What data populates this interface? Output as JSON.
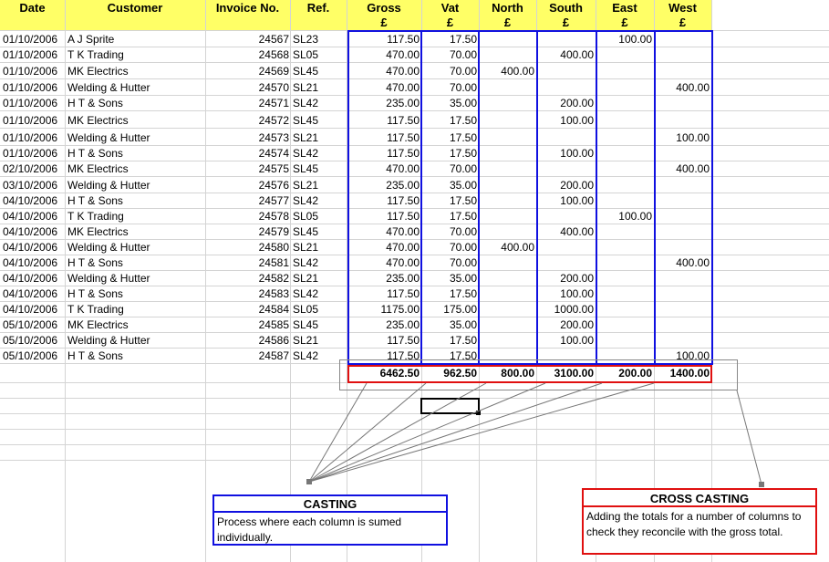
{
  "headers": {
    "date": "Date",
    "customer": "Customer",
    "invoice": "Invoice No.",
    "ref": "Ref.",
    "gross": "Gross",
    "vat": "Vat",
    "north": "North",
    "south": "South",
    "east": "East",
    "west": "West",
    "currency": "£"
  },
  "rows": [
    [
      "01/10/2006",
      "A J Sprite",
      "24567",
      "SL23",
      "117.50",
      "17.50",
      "",
      "",
      "100.00",
      ""
    ],
    [
      "01/10/2006",
      "T K Trading",
      "24568",
      "SL05",
      "470.00",
      "70.00",
      "",
      "400.00",
      "",
      ""
    ],
    [
      "01/10/2006",
      "MK Electrics",
      "24569",
      "SL45",
      "470.00",
      "70.00",
      "400.00",
      "",
      "",
      ""
    ],
    [
      "01/10/2006",
      "Welding & Hutter",
      "24570",
      "SL21",
      "470.00",
      "70.00",
      "",
      "",
      "",
      "400.00"
    ],
    [
      "01/10/2006",
      "H T & Sons",
      "24571",
      "SL42",
      "235.00",
      "35.00",
      "",
      "200.00",
      "",
      ""
    ],
    [
      "01/10/2006",
      "MK Electrics",
      "24572",
      "SL45",
      "117.50",
      "17.50",
      "",
      "100.00",
      "",
      ""
    ],
    [
      "01/10/2006",
      "Welding & Hutter",
      "24573",
      "SL21",
      "117.50",
      "17.50",
      "",
      "",
      "",
      "100.00"
    ],
    [
      "01/10/2006",
      "H T & Sons",
      "24574",
      "SL42",
      "117.50",
      "17.50",
      "",
      "100.00",
      "",
      ""
    ],
    [
      "02/10/2006",
      "MK Electrics",
      "24575",
      "SL45",
      "470.00",
      "70.00",
      "",
      "",
      "",
      "400.00"
    ],
    [
      "03/10/2006",
      "Welding & Hutter",
      "24576",
      "SL21",
      "235.00",
      "35.00",
      "",
      "200.00",
      "",
      ""
    ],
    [
      "04/10/2006",
      "H T & Sons",
      "24577",
      "SL42",
      "117.50",
      "17.50",
      "",
      "100.00",
      "",
      ""
    ],
    [
      "04/10/2006",
      "T K Trading",
      "24578",
      "SL05",
      "117.50",
      "17.50",
      "",
      "",
      "100.00",
      ""
    ],
    [
      "04/10/2006",
      "MK Electrics",
      "24579",
      "SL45",
      "470.00",
      "70.00",
      "",
      "400.00",
      "",
      ""
    ],
    [
      "04/10/2006",
      "Welding & Hutter",
      "24580",
      "SL21",
      "470.00",
      "70.00",
      "400.00",
      "",
      "",
      ""
    ],
    [
      "04/10/2006",
      "H T & Sons",
      "24581",
      "SL42",
      "470.00",
      "70.00",
      "",
      "",
      "",
      "400.00"
    ],
    [
      "04/10/2006",
      "Welding & Hutter",
      "24582",
      "SL21",
      "235.00",
      "35.00",
      "",
      "200.00",
      "",
      ""
    ],
    [
      "04/10/2006",
      "H T & Sons",
      "24583",
      "SL42",
      "117.50",
      "17.50",
      "",
      "100.00",
      "",
      ""
    ],
    [
      "04/10/2006",
      "T K Trading",
      "24584",
      "SL05",
      "1175.00",
      "175.00",
      "",
      "1000.00",
      "",
      ""
    ],
    [
      "05/10/2006",
      "MK Electrics",
      "24585",
      "SL45",
      "235.00",
      "35.00",
      "",
      "200.00",
      "",
      ""
    ],
    [
      "05/10/2006",
      "Welding & Hutter",
      "24586",
      "SL21",
      "117.50",
      "17.50",
      "",
      "100.00",
      "",
      ""
    ],
    [
      "05/10/2006",
      "H T & Sons",
      "24587",
      "SL42",
      "117.50",
      "17.50",
      "",
      "",
      "",
      "100.00"
    ]
  ],
  "totals": {
    "gross": "6462.50",
    "vat": "962.50",
    "north": "800.00",
    "south": "3100.00",
    "east": "200.00",
    "west": "1400.00"
  },
  "casting": {
    "title": "CASTING",
    "text": "Process where each column is sumed individually."
  },
  "cross_casting": {
    "title": "CROSS CASTING",
    "text": "Adding the totals for a number of columns to check they reconcile with the gross total."
  },
  "colors": {
    "header_fill": "#ffff66",
    "casting_blue": "#1010e0",
    "cross_red": "#e01010"
  }
}
